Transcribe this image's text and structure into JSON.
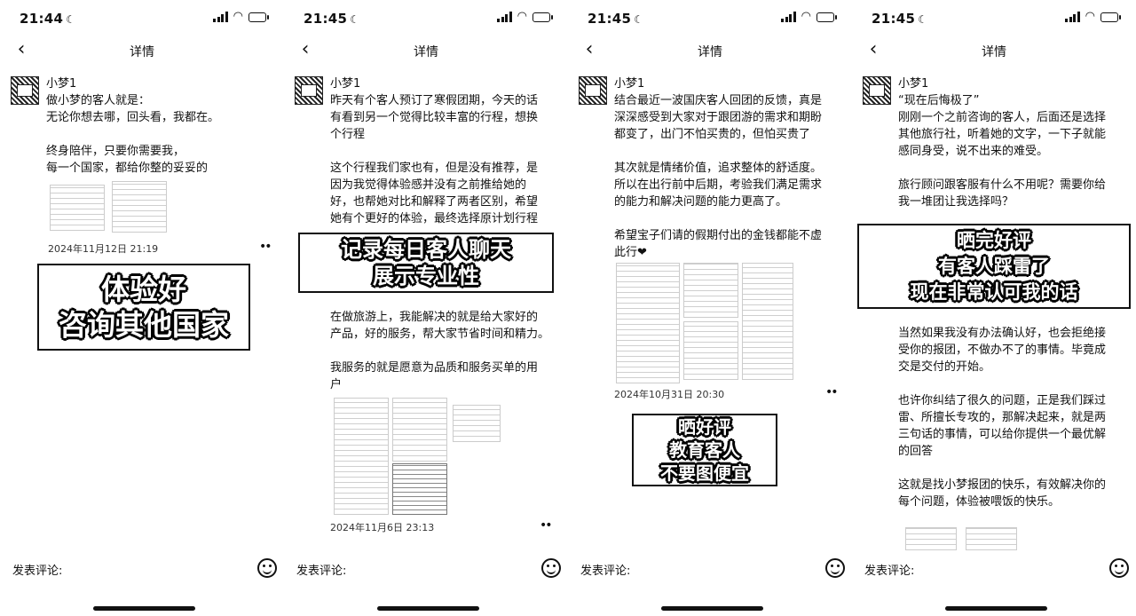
{
  "screens": [
    {
      "status_time": "21:44",
      "nav_title": "详情",
      "author": "小梦1",
      "post_lines": [
        "做小梦的客人就是：",
        "无论你想去哪，回头看，我都在。",
        "",
        "终身陪伴，只要你需要我，",
        "每一个国家，都给你整的妥妥的"
      ],
      "date": "2024年11月12日 21:19",
      "overlay_lines": [
        "体验好",
        "咨询其他国家"
      ],
      "comment_placeholder": "发表评论:"
    },
    {
      "status_time": "21:45",
      "nav_title": "详情",
      "author": "小梦1",
      "post_lines_a": [
        "昨天有个客人预订了寒假团期，今天的话",
        "有看到另一个觉得比较丰富的行程，想换",
        "个行程",
        "",
        "这个行程我们家也有，但是没有推荐，是",
        "因为我觉得体验感并没有之前推给她的",
        "好，也帮她对比和解释了两者区别，希望",
        "她有个更好的体验，最终选择原计划行程"
      ],
      "post_lines_b": [
        "在做旅游上，我能解决的就是给大家好的",
        "产品，好的服务，帮大家节省时间和精力。",
        "",
        "我服务的就是愿意为品质和服务买单的用",
        "户"
      ],
      "date": "2024年11月6日 23:13",
      "overlay_lines": [
        "记录每日客人聊天",
        "展示专业性"
      ],
      "comment_placeholder": "发表评论:"
    },
    {
      "status_time": "21:45",
      "nav_title": "详情",
      "author": "小梦1",
      "post_lines": [
        "结合最近一波国庆客人回团的反馈，真是",
        "深深感受到大家对于跟团游的需求和期盼",
        "都变了，出门不怕买贵的，但怕买贵了",
        "",
        "其次就是情绪价值，追求整体的舒适度。",
        "所以在出行前中后期，考验我们满足需求",
        "的能力和解决问题的能力更高了。",
        "",
        "希望宝子们请的假期付出的金钱都能不虚",
        "此行❤"
      ],
      "date": "2024年10月31日 20:30",
      "overlay_lines": [
        "晒好评",
        "教育客人",
        "不要图便宜"
      ],
      "comment_placeholder": "发表评论:"
    },
    {
      "status_time": "21:45",
      "nav_title": "详情",
      "author": "小梦1",
      "post_lines_a": [
        "“现在后悔极了”",
        "刚刚一个之前咨询的客人，后面还是选择",
        "其他旅行社，听着她的文字，一下子就能",
        "感同身受，说不出来的难受。",
        "",
        "旅行顾问跟客服有什么不用呢？需要你给",
        "我一堆团让我选择吗？"
      ],
      "post_lines_b": [
        "当然如果我没有办法确认好，也会拒绝接",
        "受你的报团，不做办不了的事情。毕竟成",
        "交是交付的开始。",
        "",
        "也许你纠结了很久的问题，正是我们踩过",
        "雷、所擅长专攻的，那解决起来，就是两",
        "三句话的事情，可以给你提供一个最优解",
        "的回答",
        "",
        "这就是找小梦报团的快乐，有效解决你的",
        "每个问题，体验被喂饭的快乐。"
      ],
      "overlay_lines": [
        "晒完好评",
        "有客人踩雷了",
        "现在非常认可我的话"
      ],
      "comment_placeholder": "发表评论:"
    }
  ]
}
